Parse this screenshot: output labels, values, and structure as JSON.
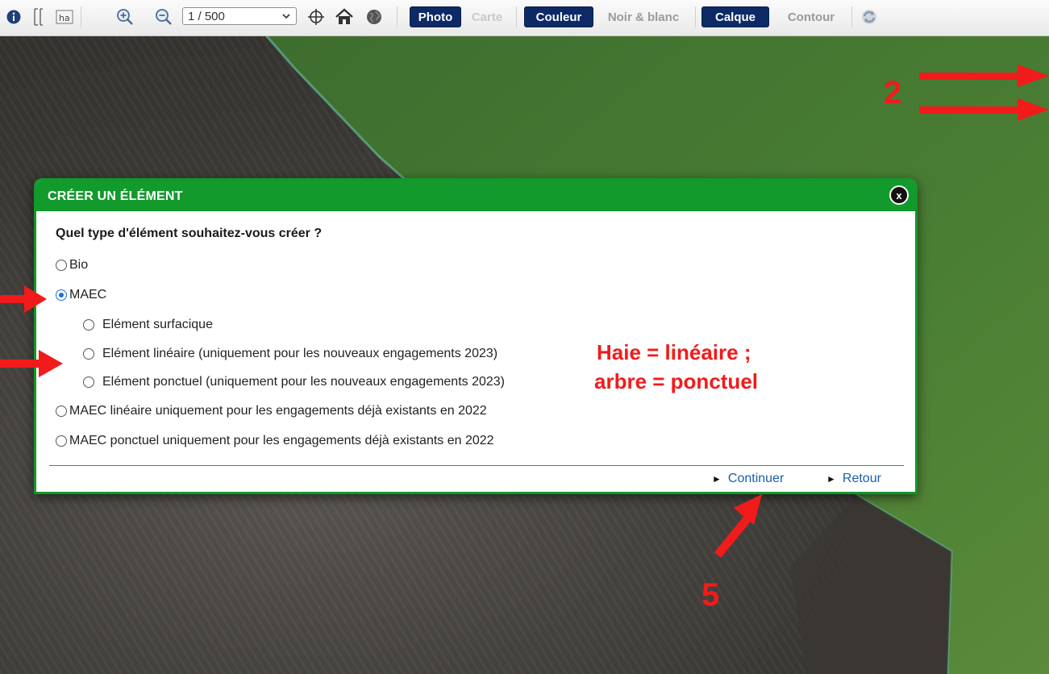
{
  "toolbar": {
    "scale_select": "1 / 500",
    "buttons": {
      "photo": "Photo",
      "carte": "Carte",
      "couleur": "Couleur",
      "noir_blanc": "Noir & blanc",
      "calque": "Calque",
      "contour": "Contour"
    },
    "icons": [
      "info-icon",
      "measure-icon",
      "ha-icon",
      "zoom-in-icon",
      "zoom-out-icon",
      "crosshair-icon",
      "home-icon",
      "globe-icon",
      "refresh-icon"
    ]
  },
  "dialog": {
    "title": "CRÉER UN ÉLÉMENT",
    "close_label": "x",
    "question": "Quel type d'élément souhaitez-vous créer ?",
    "options": [
      {
        "label": "Bio",
        "checked": false
      },
      {
        "label": "MAEC",
        "checked": true
      },
      {
        "label": "Elément surfacique",
        "checked": false
      },
      {
        "label": "Elément linéaire (uniquement pour les nouveaux engagements 2023)",
        "checked": false
      },
      {
        "label": "Elément ponctuel (uniquement pour les nouveaux engagements 2023)",
        "checked": false
      },
      {
        "label": "MAEC linéaire uniquement pour les engagements déjà existants en 2022",
        "checked": false
      },
      {
        "label": "MAEC ponctuel uniquement pour les engagements déjà existants en 2022",
        "checked": false
      }
    ],
    "actions": {
      "continue": "Continuer",
      "back": "Retour"
    }
  },
  "annotations": {
    "step_2": "2",
    "step_5": "5",
    "note_line1": "Haie = linéaire ;",
    "note_line2": "arbre = ponctuel",
    "color": "#f11b1b"
  },
  "colors": {
    "dialog_green": "#139a2c",
    "button_navy": "#0d2a66",
    "field_green": "#3f7a2c"
  }
}
